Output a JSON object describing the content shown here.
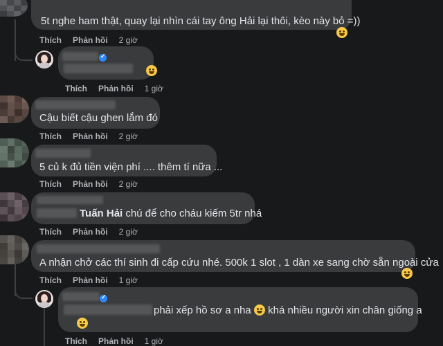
{
  "labels": {
    "like": "Thích",
    "reply": "Phản hồi"
  },
  "comments": [
    {
      "text": "5t nghe ham thật, quay lại nhìn cái tay ông Hải lại thôi, kèo này bỏ =))",
      "time": "2 giờ"
    },
    {
      "time": "1 giờ"
    },
    {
      "text": "Cậu biết cậu ghen lắm đó",
      "time": "2 giờ"
    },
    {
      "text": "5 củ k đủ tiền viện phí .... thêm tí nữa ...",
      "time": "2 giờ"
    },
    {
      "mention": "Tuấn Hải",
      "text": "chú để cho cháu kiếm 5tr nhá",
      "time": "2 giờ"
    },
    {
      "text": "A nhận chở các thí sinh đi cấp cứu nhé. 500k 1 slot , 1 dàn xe sang chờ sẵn ngoài cửa",
      "time": "1 giờ"
    },
    {
      "text_a": "phải xếp hồ sơ a nha",
      "text_b": "khá nhiều người xin chân giống a",
      "time": "1 giờ"
    }
  ],
  "icons": [
    "laughing-emoji-icon",
    "rofl-emoji-icon",
    "verified-badge-icon"
  ],
  "colors": {
    "background": "#18191a",
    "bubble": "#3a3b3c",
    "text": "#e4e6eb",
    "secondary": "#b0b3b8",
    "verified": "#2d88ff"
  }
}
